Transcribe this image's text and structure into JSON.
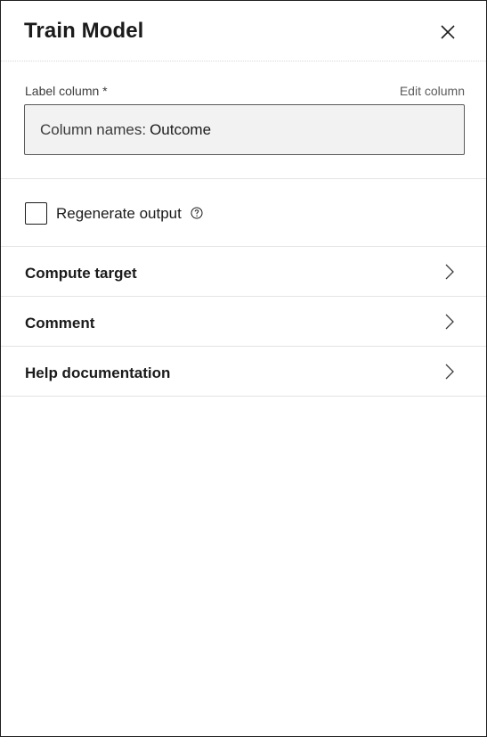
{
  "panel": {
    "title": "Train Model",
    "close_icon": "close-icon"
  },
  "label_column": {
    "label": "Label column *",
    "edit_link": "Edit column",
    "prefix": "Column names:",
    "value": "Outcome"
  },
  "regenerate": {
    "label": "Regenerate output",
    "checked": false,
    "help_icon": "help-circle-icon"
  },
  "sections": [
    {
      "label": "Compute target",
      "icon": "chevron-right-icon"
    },
    {
      "label": "Comment",
      "icon": "chevron-right-icon"
    },
    {
      "label": "Help documentation",
      "icon": "chevron-right-icon"
    }
  ],
  "colors": {
    "border": "#1f1f1f",
    "divider": "#e4e4e4",
    "input_bg": "#f2f2f2",
    "text": "#1b1b1b",
    "link": "#5c5c5c"
  }
}
